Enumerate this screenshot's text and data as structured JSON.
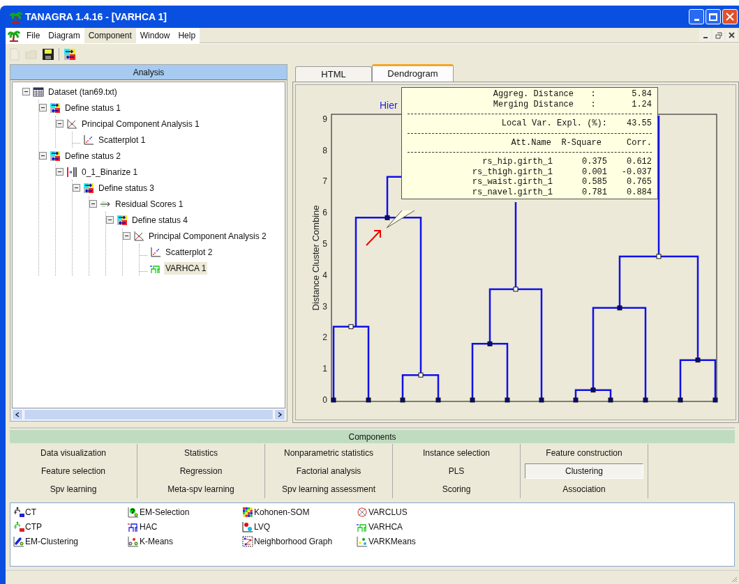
{
  "window": {
    "title": "TANAGRA 1.4.16 - [VARHCA 1]"
  },
  "menu": [
    {
      "label": "File",
      "selected": false
    },
    {
      "label": "Diagram",
      "selected": false
    },
    {
      "label": "Component",
      "selected": true
    },
    {
      "label": "Window",
      "selected": false
    },
    {
      "label": "Help",
      "selected": false
    }
  ],
  "toolbar": [
    {
      "kind": "new",
      "disabled": true
    },
    {
      "kind": "open",
      "disabled": true
    },
    {
      "kind": "save",
      "disabled": false
    },
    {
      "kind": "status",
      "disabled": false
    }
  ],
  "analysis": {
    "title": "Analysis",
    "tree": [
      {
        "label": "Dataset (tan69.txt)",
        "kind": "dataset",
        "selected": false,
        "expanded": true,
        "children": [
          {
            "label": "Define status 1",
            "kind": "status",
            "selected": false,
            "expanded": true,
            "children": [
              {
                "label": "Principal Component Analysis 1",
                "kind": "pca",
                "selected": false,
                "expanded": true,
                "children": [
                  {
                    "label": "Scatterplot 1",
                    "kind": "scatter",
                    "selected": false
                  }
                ]
              }
            ]
          },
          {
            "label": "Define status 2",
            "kind": "status",
            "selected": false,
            "expanded": true,
            "children": [
              {
                "label": "0_1_Binarize 1",
                "kind": "binarize",
                "selected": false,
                "expanded": true,
                "children": [
                  {
                    "label": "Define status 3",
                    "kind": "status",
                    "selected": false,
                    "expanded": true,
                    "children": [
                      {
                        "label": "Residual Scores 1",
                        "kind": "residual",
                        "selected": false,
                        "expanded": true,
                        "children": [
                          {
                            "label": "Define status 4",
                            "kind": "status",
                            "selected": false,
                            "expanded": true,
                            "children": [
                              {
                                "label": "Principal Component Analysis 2",
                                "kind": "pca",
                                "selected": false,
                                "expanded": true,
                                "children": [
                                  {
                                    "label": "Scatterplot 2",
                                    "kind": "scatter",
                                    "selected": false
                                  },
                                  {
                                    "label": "VARHCA 1",
                                    "kind": "varhca",
                                    "selected": true
                                  }
                                ]
                              }
                            ]
                          }
                        ]
                      }
                    ]
                  }
                ]
              }
            ]
          }
        ]
      }
    ]
  },
  "result_tabs": [
    {
      "label": "HTML",
      "selected": false
    },
    {
      "label": "Dendrogram",
      "selected": true
    }
  ],
  "dendrogram": {
    "title": "Hier",
    "ylabel": "Distance Cluster Combine",
    "yticks": [
      "9",
      "8",
      "7",
      "6",
      "5",
      "4",
      "3",
      "2",
      "1",
      "0"
    ],
    "tooltip": {
      "distances": [
        {
          "label": "Aggreg. Distance",
          "separator": ":",
          "value": "5.84"
        },
        {
          "label": "Merging Distance",
          "separator": ":",
          "value": "1.24"
        }
      ],
      "local_variance": {
        "label": "Local Var. Expl. (%):",
        "value": "43.55"
      },
      "columns": [
        "Att.Name",
        "R-Square",
        "Corr."
      ],
      "rows": [
        [
          "rs_hip.girth_1",
          "0.375",
          "0.612"
        ],
        [
          "rs_thigh.girth_1",
          "0.001",
          "-0.037"
        ],
        [
          "rs_waist.girth_1",
          "0.585",
          "0.765"
        ],
        [
          "rs_navel.girth_1",
          "0.781",
          "0.884"
        ]
      ]
    }
  },
  "components": {
    "title": "Components",
    "tabs": [
      {
        "label": "Data visualization",
        "selected": false
      },
      {
        "label": "Statistics",
        "selected": false
      },
      {
        "label": "Nonparametric statistics",
        "selected": false
      },
      {
        "label": "Instance selection",
        "selected": false
      },
      {
        "label": "Feature construction",
        "selected": false
      },
      {
        "label": "Feature selection",
        "selected": false
      },
      {
        "label": "Regression",
        "selected": false
      },
      {
        "label": "Factorial analysis",
        "selected": false
      },
      {
        "label": "PLS",
        "selected": false
      },
      {
        "label": "Clustering",
        "selected": true
      },
      {
        "label": "Spv learning",
        "selected": false
      },
      {
        "label": "Meta-spv learning",
        "selected": false
      },
      {
        "label": "Spv learning assessment",
        "selected": false
      },
      {
        "label": "Scoring",
        "selected": false
      },
      {
        "label": "Association",
        "selected": false
      }
    ],
    "items": [
      [
        {
          "label": "CT",
          "kind": "tree"
        },
        {
          "label": "CTP",
          "kind": "tree2"
        },
        {
          "label": "EM-Clustering",
          "kind": "em"
        }
      ],
      [
        {
          "label": "EM-Selection",
          "kind": "emsel"
        },
        {
          "label": "HAC",
          "kind": "hac"
        },
        {
          "label": "K-Means",
          "kind": "kmeans"
        }
      ],
      [
        {
          "label": "Kohonen-SOM",
          "kind": "som"
        },
        {
          "label": "LVQ",
          "kind": "lvq"
        },
        {
          "label": "Neighborhood Graph",
          "kind": "graph"
        }
      ],
      [
        {
          "label": "VARCLUS",
          "kind": "varclus"
        },
        {
          "label": "VARHCA",
          "kind": "varhca"
        },
        {
          "label": "VARKMeans",
          "kind": "varkmeans"
        }
      ]
    ]
  }
}
